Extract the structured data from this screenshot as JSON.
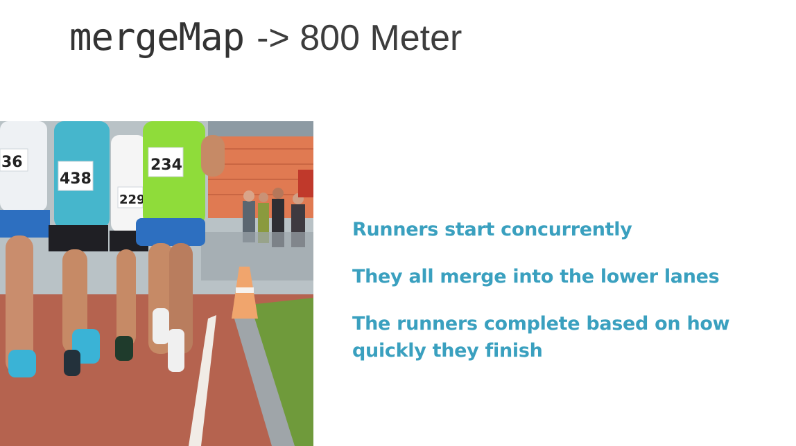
{
  "slide": {
    "title_code": "mergeMap",
    "title_rest": "-> 800 Meter"
  },
  "photo": {
    "subject": "runners-on-track",
    "bib_numbers": [
      "36",
      "438",
      "229",
      "234"
    ]
  },
  "bullets": [
    "Runners start concurrently",
    "They all merge into the lower lanes",
    "The runners complete based on how quickly they finish"
  ],
  "colors": {
    "accent": "#3aa0bf",
    "title": "#333333",
    "track": "#b5634f",
    "grass": "#6f9a3b"
  }
}
